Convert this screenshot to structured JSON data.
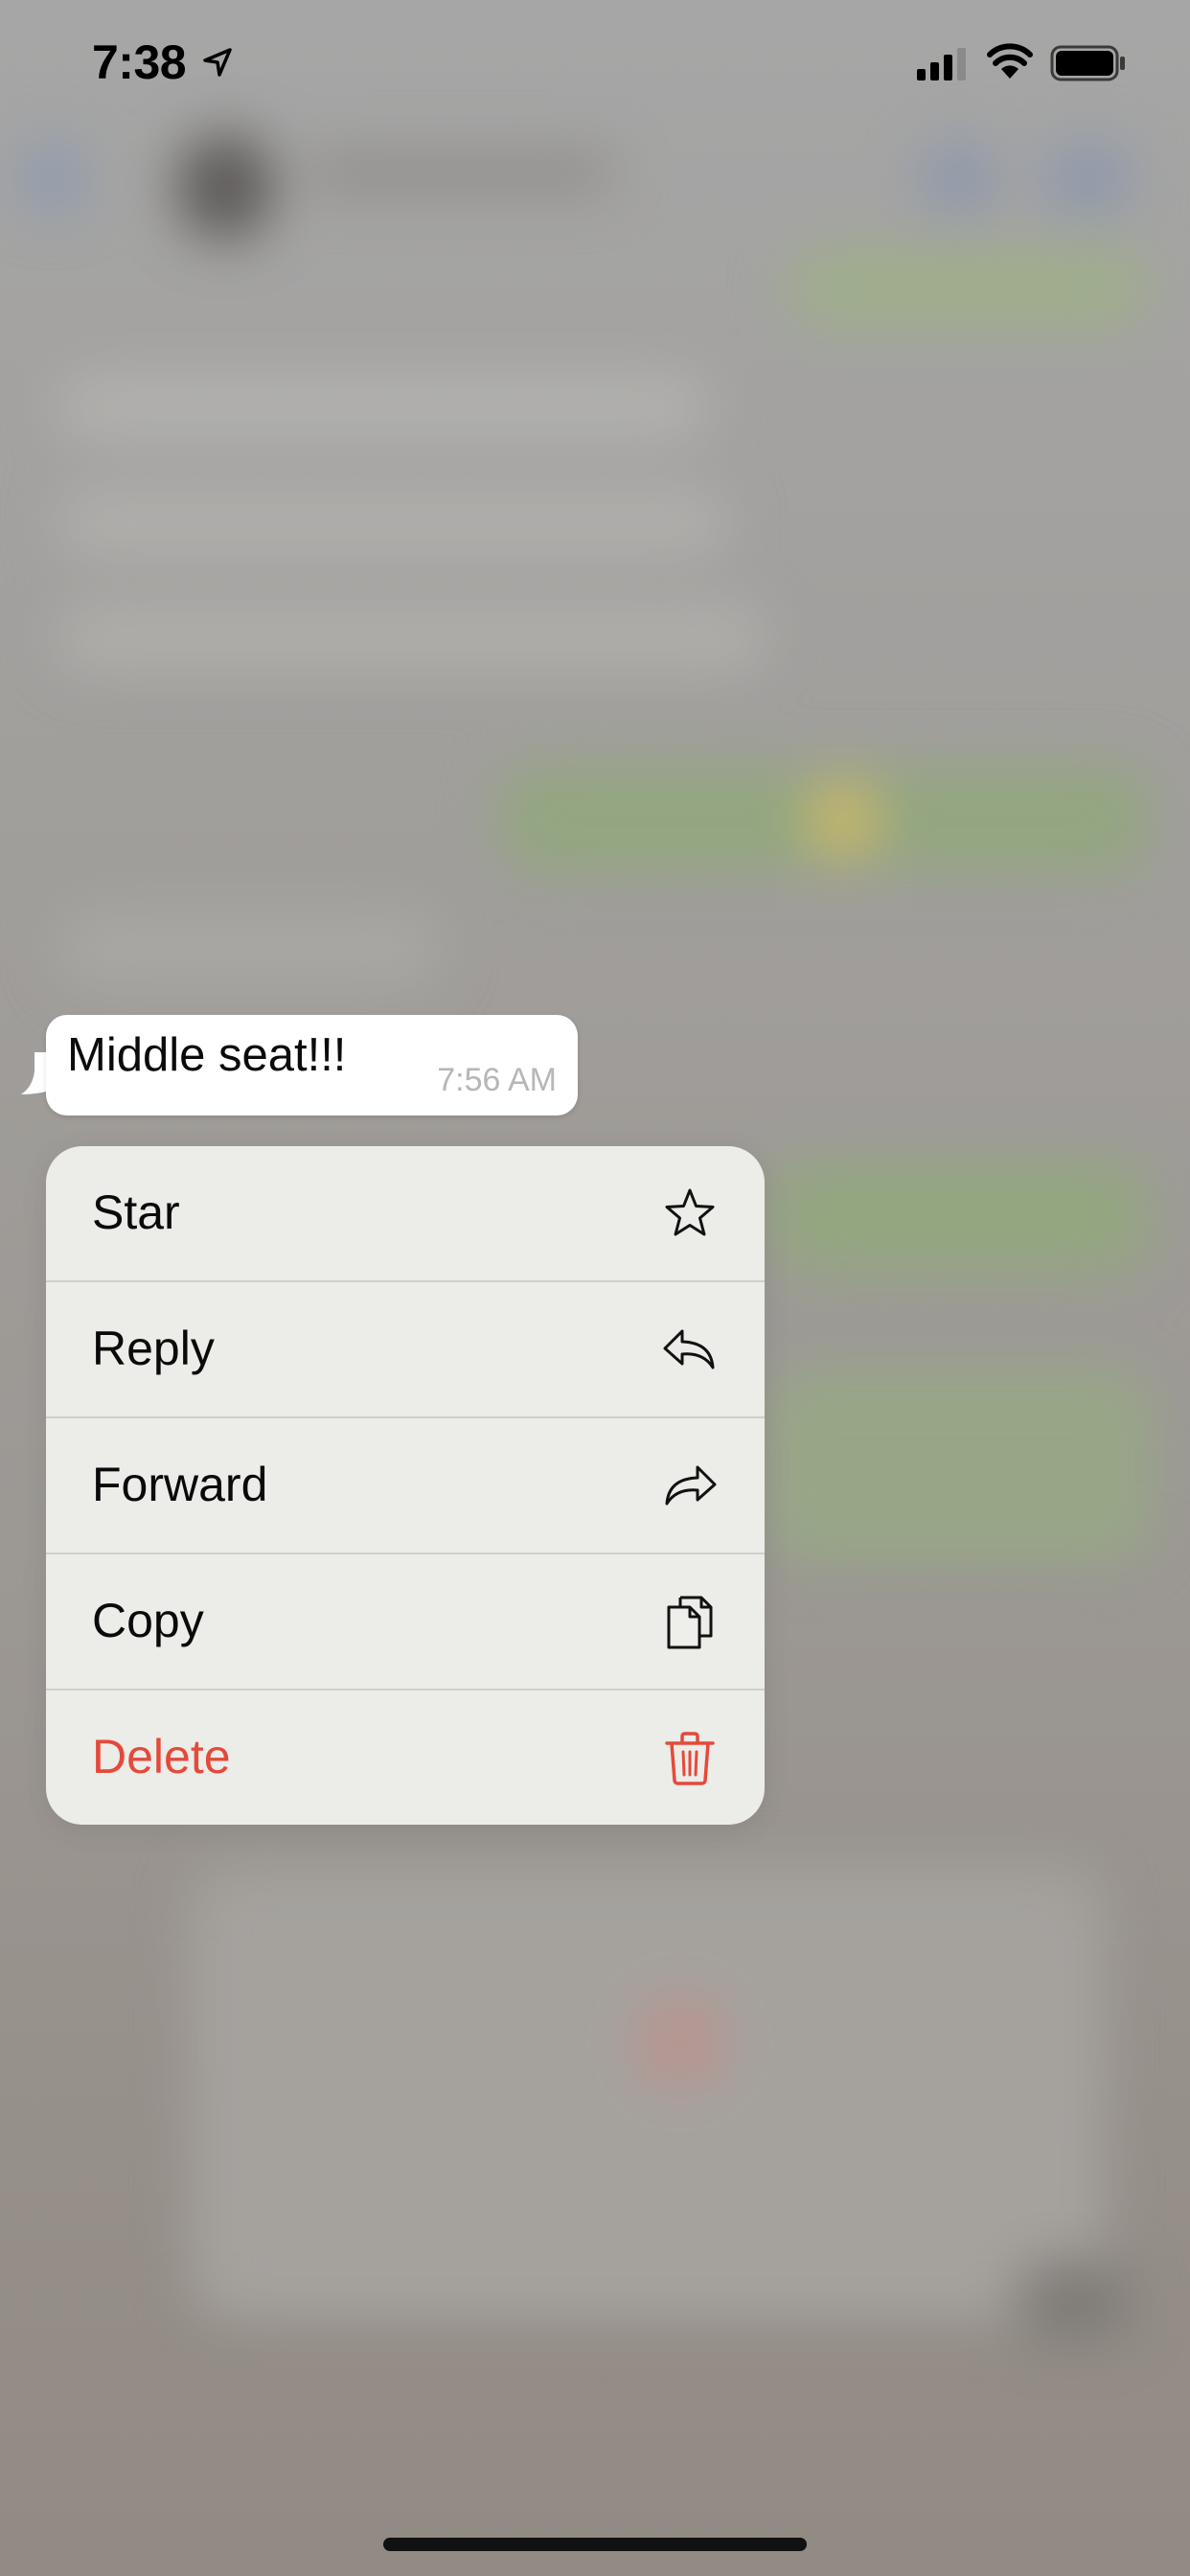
{
  "status_bar": {
    "time": "7:38",
    "location_icon": "location-arrow-icon",
    "signal_icon": "cellular-signal-icon",
    "wifi_icon": "wifi-icon",
    "battery_icon": "battery-icon"
  },
  "message": {
    "text": "Middle seat!!!",
    "time": "7:56 AM"
  },
  "context_menu": {
    "items": [
      {
        "label": "Star",
        "icon": "star-icon",
        "destructive": false
      },
      {
        "label": "Reply",
        "icon": "reply-icon",
        "destructive": false
      },
      {
        "label": "Forward",
        "icon": "forward-icon",
        "destructive": false
      },
      {
        "label": "Copy",
        "icon": "copy-icon",
        "destructive": false
      },
      {
        "label": "Delete",
        "icon": "trash-icon",
        "destructive": true
      }
    ]
  },
  "colors": {
    "destructive": "#e5493a",
    "menu_background": "#eeeeea",
    "bubble_background": "#ffffff"
  }
}
